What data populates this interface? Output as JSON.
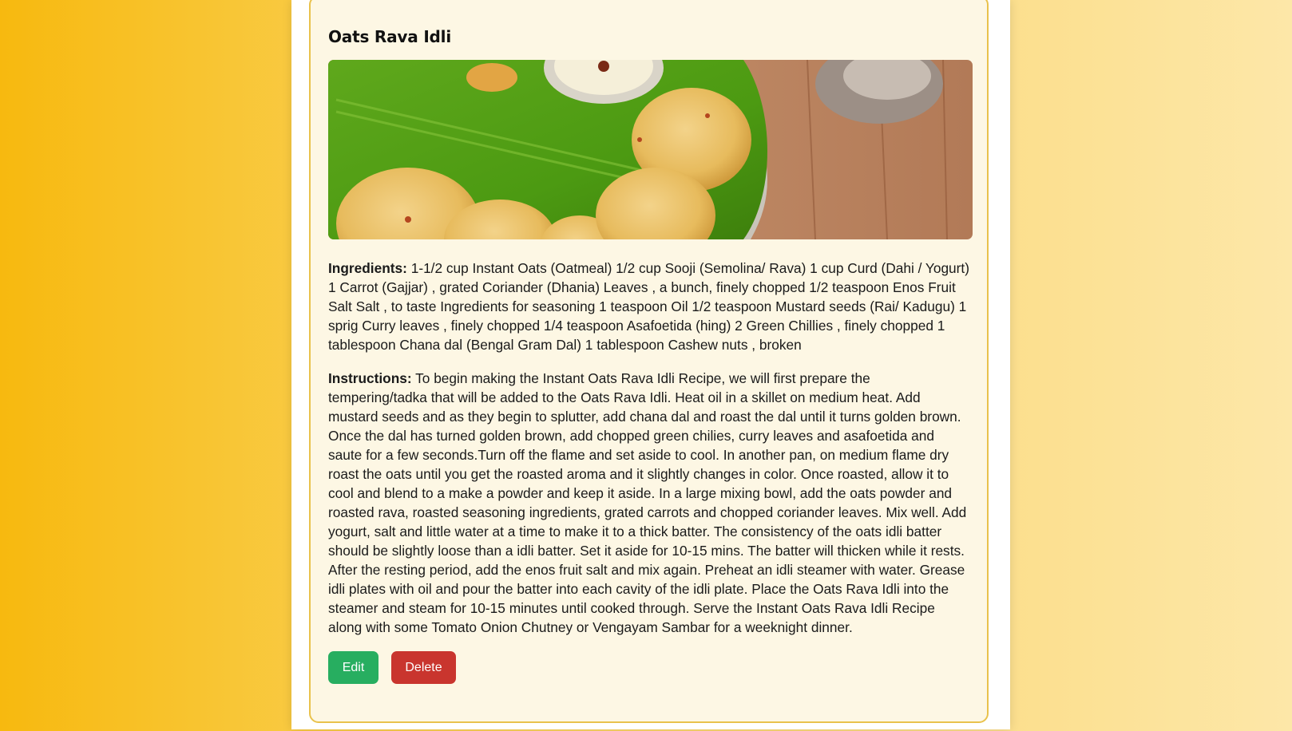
{
  "recipe": {
    "title": "Oats Rava Idli",
    "image_alt": "Oats Rava Idli served on a banana leaf",
    "ingredients_label": "Ingredients:",
    "ingredients_text": " 1-1/2 cup Instant Oats (Oatmeal) 1/2 cup Sooji (Semolina/ Rava) 1 cup Curd (Dahi / Yogurt) 1 Carrot (Gajjar) , grated Coriander (Dhania) Leaves , a bunch, finely chopped 1/2 teaspoon Enos Fruit Salt Salt , to taste Ingredients for seasoning 1 teaspoon Oil 1/2 teaspoon Mustard seeds (Rai/ Kadugu) 1 sprig Curry leaves , finely chopped 1/4 teaspoon Asafoetida (hing) 2 Green Chillies , finely chopped 1 tablespoon Chana dal (Bengal Gram Dal) 1 tablespoon Cashew nuts , broken",
    "instructions_label": "Instructions:",
    "instructions_text": " To begin making the Instant Oats Rava Idli Recipe, we will first prepare the tempering/tadka that will be added to the Oats Rava Idli. Heat oil in a skillet on medium heat. Add mustard seeds and as they begin to splutter, add chana dal and roast the dal until it turns golden brown. Once the dal has turned golden brown, add chopped green chilies, curry leaves and asafoetida and saute for a few seconds.Turn off the flame and set aside to cool. In another pan, on medium flame dry roast the oats until you get the roasted aroma and it slightly changes in color. Once roasted, allow it to cool and blend to a make a powder and keep it aside. In a large mixing bowl, add the oats powder and roasted rava, roasted seasoning ingredients, grated carrots and chopped coriander leaves. Mix well. Add yogurt, salt and little water at a time to make it to a thick batter. The consistency of the oats idli batter should be slightly loose than a idli batter. Set it aside for 10-15 mins. The batter will thicken while it rests. After the resting period, add the enos fruit salt and mix again. Preheat an idli steamer with water. Grease idli plates with oil and pour the batter into each cavity of the idli plate. Place the Oats Rava Idli into the steamer and steam for 10-15 minutes until cooked through. Serve the Instant Oats Rava Idli Recipe along with some Tomato Onion Chutney or Vengayam Sambar for a weeknight dinner."
  },
  "actions": {
    "edit_label": "Edit",
    "delete_label": "Delete"
  },
  "colors": {
    "edit": "#27ae60",
    "delete": "#c9352e",
    "card_border": "#e9c24c",
    "card_background": "#fdf7e4"
  }
}
